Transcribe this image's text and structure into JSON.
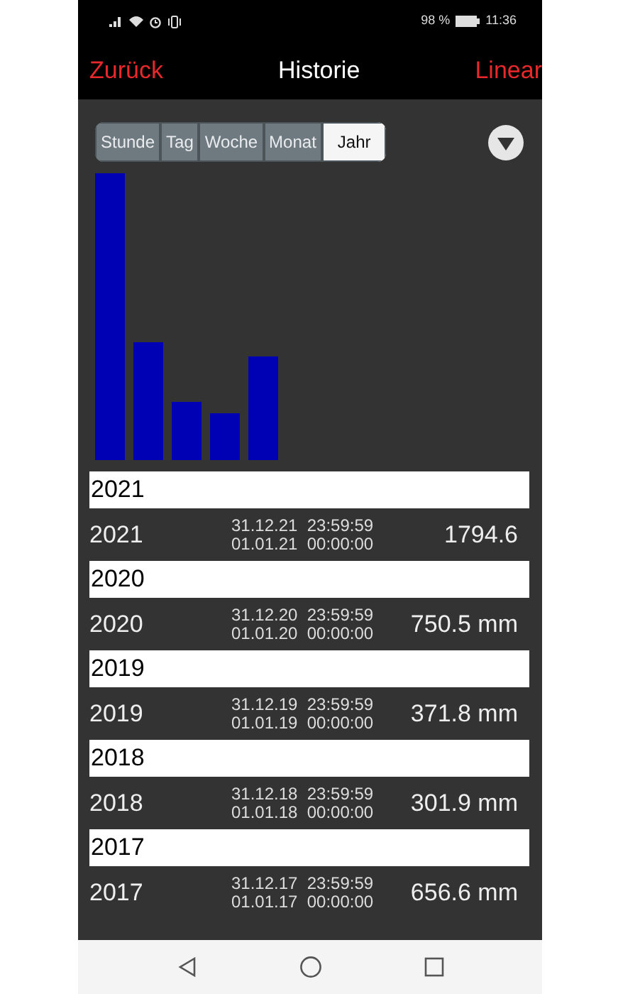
{
  "status_bar": {
    "battery": "98 %",
    "time": "11:36"
  },
  "header": {
    "back": "Zurück",
    "title": "Historie",
    "mode": "Linear"
  },
  "segments": [
    {
      "label": "Stunde",
      "selected": false
    },
    {
      "label": "Tag",
      "selected": false
    },
    {
      "label": "Woche",
      "selected": false
    },
    {
      "label": "Monat",
      "selected": false
    },
    {
      "label": "Jahr",
      "selected": true
    }
  ],
  "sections": [
    {
      "header": "2021",
      "label": "2021",
      "end": "31.12.21  23:59:59",
      "start": "01.01.21  00:00:00",
      "value": "1794.6"
    },
    {
      "header": "2020",
      "label": "2020",
      "end": "31.12.20  23:59:59",
      "start": "01.01.20  00:00:00",
      "value": "750.5 mm"
    },
    {
      "header": "2019",
      "label": "2019",
      "end": "31.12.19  23:59:59",
      "start": "01.01.19  00:00:00",
      "value": "371.8 mm"
    },
    {
      "header": "2018",
      "label": "2018",
      "end": "31.12.18  23:59:59",
      "start": "01.01.18  00:00:00",
      "value": "301.9 mm"
    },
    {
      "header": "2017",
      "label": "2017",
      "end": "31.12.17  23:59:59",
      "start": "01.01.17  00:00:00",
      "value": "656.6 mm"
    }
  ]
}
